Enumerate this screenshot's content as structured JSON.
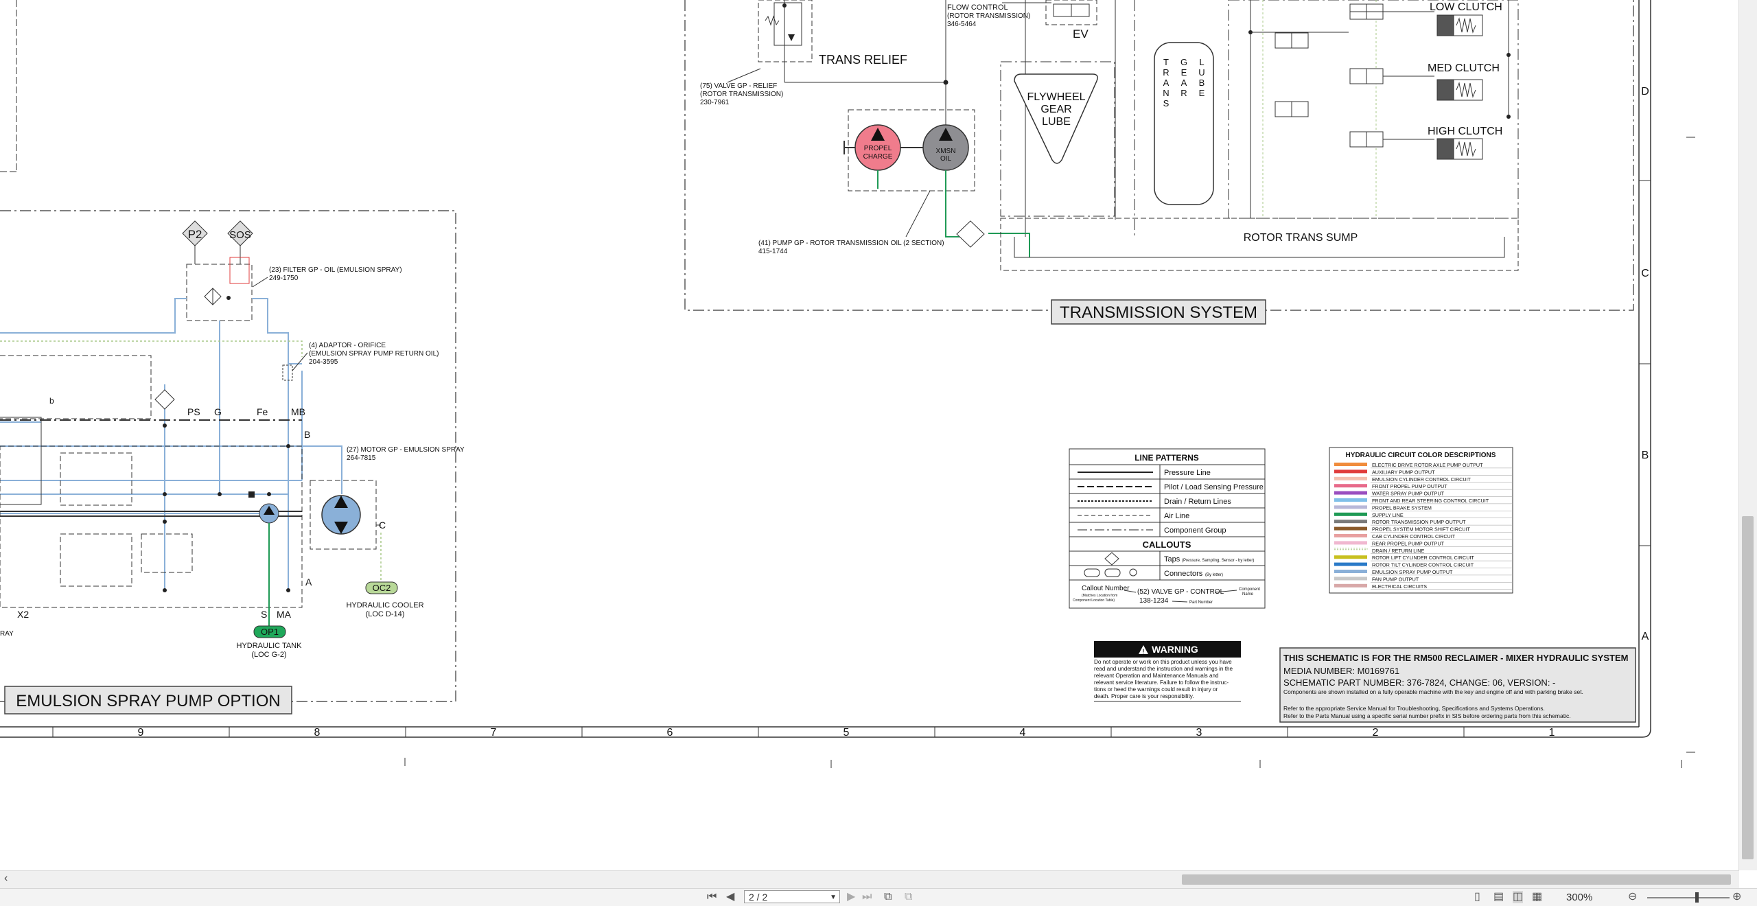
{
  "trans": {
    "flow_control": [
      "FLOW CONTROL",
      "(ROTOR TRANSMISSION)",
      "346-5464"
    ],
    "ev": "EV",
    "trans_relief": "TRANS RELIEF",
    "valve75": [
      "(75) VALVE GP - RELIEF",
      "(ROTOR TRANSMISSION)",
      "230-7961"
    ],
    "flywheel": [
      "FLYWHEEL",
      "GEAR",
      "LUBE"
    ],
    "trans_lube_cols": [
      [
        "T",
        "R",
        "A",
        "N",
        "S"
      ],
      [
        "G",
        "E",
        "A",
        "R"
      ],
      [
        "L",
        "U",
        "B",
        "E"
      ]
    ],
    "clutches": [
      "LOW CLUTCH",
      "MED CLUTCH",
      "HIGH CLUTCH"
    ],
    "propel": [
      "PROPEL",
      "CHARGE"
    ],
    "xmsn": [
      "XMSN",
      "OIL"
    ],
    "pump41": [
      "(41) PUMP GP - ROTOR TRANSMISSION OIL (2 SECTION)",
      "415-1744"
    ],
    "sump": "ROTOR TRANS SUMP",
    "title": "TRANSMISSION SYSTEM"
  },
  "emulsion": {
    "p2": "P2",
    "sos": "SOS",
    "filter23": [
      "(23) FILTER GP - OIL (EMULSION SPRAY)",
      "249-1750"
    ],
    "adaptor4": [
      "(4) ADAPTOR - ORIFICE",
      "(EMULSION SPRAY PUMP RETURN OIL)",
      "204-3595"
    ],
    "port_ps": "PS",
    "port_g": "G",
    "port_fe": "Fe",
    "port_mb": "MB",
    "port_b": "B",
    "port_a": "A",
    "port_c": "C",
    "port_s": "S",
    "port_ma": "MA",
    "port_x2": "X2",
    "port_b_small": "b",
    "motor27": [
      "(27) MOTOR GP - EMULSION SPRAY",
      "264-7815"
    ],
    "op1": "OP1",
    "tank": [
      "HYDRAULIC TANK",
      "(LOC G-2)"
    ],
    "oc2": "OC2",
    "cooler": [
      "HYDRAULIC COOLER",
      "(LOC D-14)"
    ],
    "ray": "RAY",
    "title": "EMULSION SPRAY PUMP OPTION"
  },
  "line_patterns": {
    "header": "LINE PATTERNS",
    "items": [
      "Pressure Line",
      "Pilot / Load Sensing Pressure",
      "Drain / Return Lines",
      "Air Line",
      "Component Group"
    ],
    "callouts_header": "CALLOUTS",
    "taps": "Taps",
    "taps_note": "(Pressure, Sampling, Sensor - by letter)",
    "connectors": "Connectors",
    "connectors_note": "(By letter)",
    "callout_number": "Callout Number",
    "callout_note": [
      "(Matches Location from",
      "Component Location Table)"
    ],
    "callout_example": [
      "(52) VALVE GP - CONTROL",
      "138-1234"
    ],
    "component_name": [
      "Component",
      "Name"
    ],
    "part_number": "Part Number"
  },
  "color_legend": {
    "header": "HYDRAULIC CIRCUIT COLOR DESCRIPTIONS",
    "items": [
      {
        "label": "ELECTRIC DRIVE ROTOR AXLE PUMP OUTPUT",
        "color": "#f08c3c"
      },
      {
        "label": "AUXILIARY PUMP OUTPUT",
        "color": "#e03c3c"
      },
      {
        "label": "EMULSION CYLINDER CONTROL CIRCUIT",
        "color": "#f4c0b0"
      },
      {
        "label": "FRONT PROPEL PUMP OUTPUT",
        "color": "#e86a8a"
      },
      {
        "label": "WATER SPRAY PUMP OUTPUT",
        "color": "#9a4fc0"
      },
      {
        "label": "FRONT AND REAR STEERING CONTROL CIRCUIT",
        "color": "#80c0e8"
      },
      {
        "label": "PROPEL BRAKE SYSTEM",
        "color": "#b8b8d8"
      },
      {
        "label": "SUPPLY LINE",
        "color": "#1f9a55"
      },
      {
        "label": "ROTOR TRANSMISSION PUMP OUTPUT",
        "color": "#7a7a7a"
      },
      {
        "label": "PROPEL SYSTEM MOTOR SHIFT CIRCUIT",
        "color": "#8a5a2a"
      },
      {
        "label": "CAB CYLINDER CONTROL CIRCUIT",
        "color": "#e8a0a0"
      },
      {
        "label": "REAR PROPEL PUMP OUTPUT",
        "color": "#f0b8d0"
      },
      {
        "label": "DRAIN / RETURN LINE",
        "color": "#a8c888"
      },
      {
        "label": "ROTOR LIFT CYLINDER CONTROL CIRCUIT",
        "color": "#c8c020"
      },
      {
        "label": "ROTOR TILT CYLINDER CONTROL CIRCUIT",
        "color": "#2a7ac8"
      },
      {
        "label": "EMULSION SPRAY PUMP OUTPUT",
        "color": "#8ab0d8"
      },
      {
        "label": "FAN PUMP OUTPUT",
        "color": "#c8c8c8"
      },
      {
        "label": "ELECTRICAL CIRCUITS",
        "color": "#d8a8a8"
      }
    ]
  },
  "warning": {
    "title": "WARNING",
    "lines": [
      "Do not operate or work on this product unless you have",
      "read and understand the instruction and warnings in the",
      "relevant Operation and Maintenance Manuals and",
      "relevant service literature. Failure to follow the instruc-",
      "tions or heed the warnings could result in injury or",
      "death. Proper care is your responsibility."
    ]
  },
  "title_block": {
    "line1": "THIS SCHEMATIC IS FOR THE RM500 RECLAIMER - MIXER HYDRAULIC SYSTEM",
    "media": "MEDIA NUMBER: M0169761",
    "part": "SCHEMATIC PART NUMBER: 376-7824, CHANGE: 06, VERSION: -",
    "note1": "Components are shown installed on a fully operable machine with the key and engine off and with parking brake set.",
    "note2": "Refer to the appropriate Service Manual for Troubleshooting, Specifications and Systems Operations.",
    "note3": "Refer to the Parts Manual using a specific serial number prefix in SIS before ordering parts from this schematic."
  },
  "border": {
    "columns": [
      "9",
      "8",
      "7",
      "6",
      "5",
      "4",
      "3",
      "2",
      "1"
    ],
    "rows": [
      "D",
      "C",
      "B",
      "A"
    ]
  },
  "viewer": {
    "page_value": "2 / 2",
    "zoom": "300%"
  }
}
